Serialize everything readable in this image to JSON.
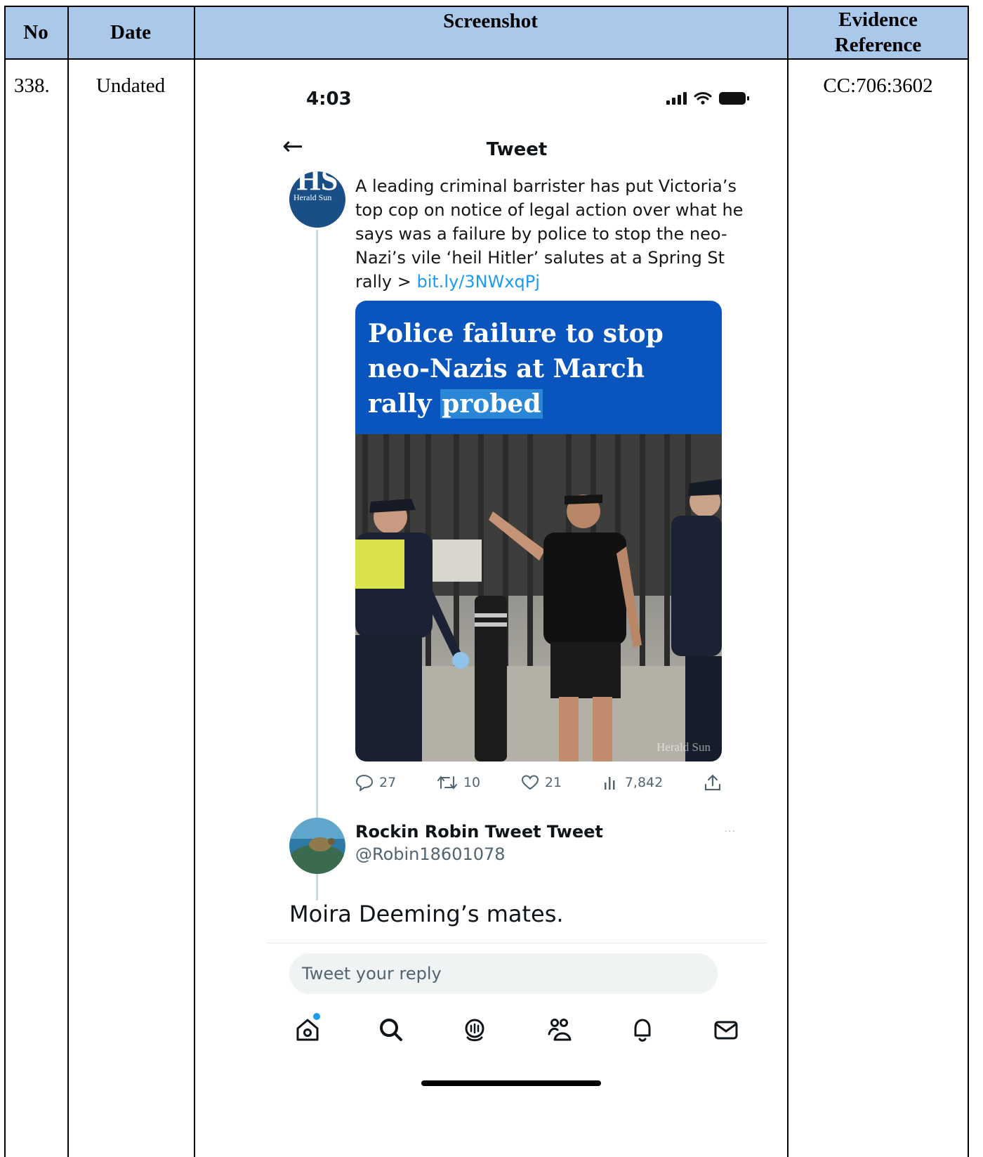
{
  "table": {
    "headers": {
      "no": "No",
      "date": "Date",
      "screenshot": "Screenshot",
      "evidence_line1": "Evidence",
      "evidence_line2": "Reference"
    },
    "row": {
      "no": "338.",
      "date": "Undated",
      "evidence": "CC:706:3602"
    },
    "header_color": "#a9c8ea"
  },
  "phone": {
    "status_time": "4:03",
    "nav_title": "Tweet",
    "tweet": {
      "avatar_big": "HS",
      "avatar_small": "Herald Sun",
      "text_main": "A leading criminal barrister has put Victoria’s top cop on notice of legal action over what he says was a failure by police to stop the neo-Nazi’s vile ‘heil Hitler’ salutes at a Spring St rally > ",
      "link": "bit.ly/3NWxqPj",
      "card_headline_part1": "Police failure to stop neo-Nazis at March rally ",
      "card_headline_highlight": "probed",
      "card_watermark": "Herald Sun",
      "actions": {
        "replies": "27",
        "retweets": "10",
        "likes": "21",
        "views": "7,842"
      }
    },
    "reply": {
      "name": "Rockin Robin Tweet Tweet",
      "handle": "@Robin18601078",
      "more": "···",
      "text": "Moira Deeming’s mates."
    },
    "reply_placeholder": "Tweet your reply",
    "colors": {
      "link": "#1d9bf0",
      "card_blue": "#0a55bd",
      "muted": "#536471"
    }
  }
}
